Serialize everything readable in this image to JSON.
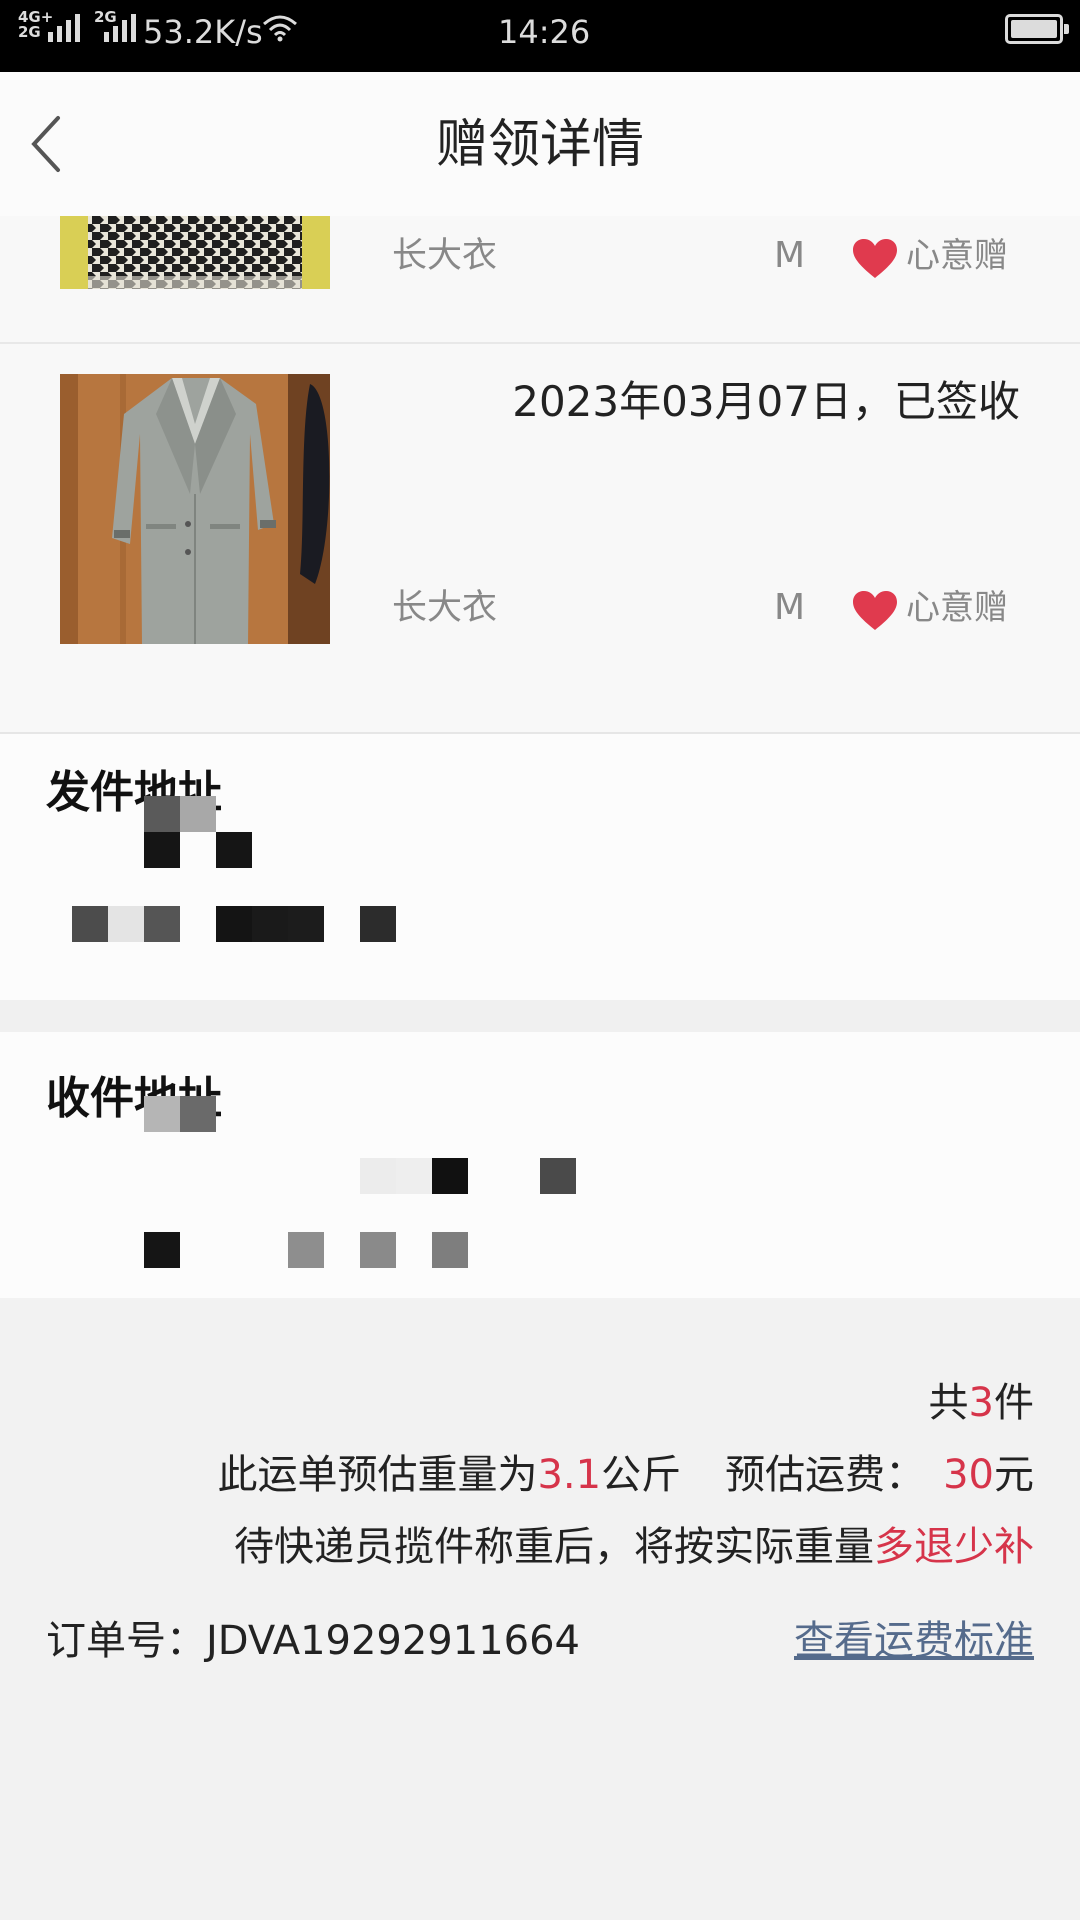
{
  "status_bar": {
    "network": "4G+\n2G",
    "sim2": "2G",
    "speed": "53.2K/s",
    "time": "14:26",
    "battery_level": 1.0
  },
  "header": {
    "title": "赠领详情"
  },
  "items": [
    {
      "name": "长大衣",
      "size": "M",
      "gift_label": "心意赠"
    },
    {
      "date_status": "2023年03月07日，已签收",
      "name": "长大衣",
      "size": "M",
      "gift_label": "心意赠"
    }
  ],
  "addresses": {
    "sender_title": "发件地址",
    "receiver_title": "收件地址"
  },
  "summary": {
    "count_prefix": "共",
    "count": "3",
    "count_suffix": "件",
    "weight_prefix": "此运单预估重量为",
    "weight": "3.1",
    "weight_unit": "公斤",
    "fee_label": "预估运费：",
    "fee": "30",
    "fee_unit": "元",
    "note_prefix": "待快递员揽件称重后，将按实际重量",
    "note_highlight": "多退少补"
  },
  "order": {
    "label": "订单号：",
    "number": "JDVA19292911664",
    "fee_standard_link": "查看运费标准"
  },
  "colors": {
    "accent_red": "#d6344a",
    "link": "#556b8c",
    "heart": "#e03a4e"
  }
}
